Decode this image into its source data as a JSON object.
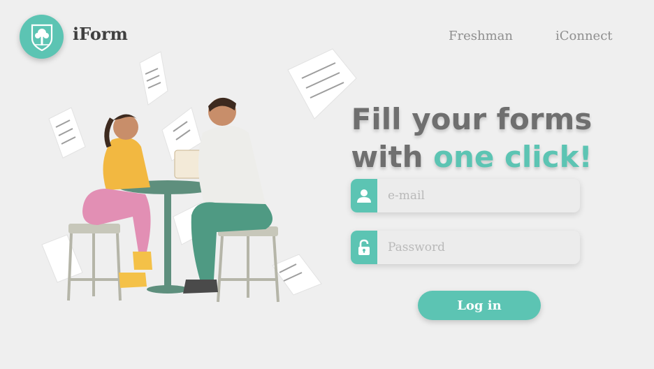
{
  "brand": {
    "name": "iForm"
  },
  "nav": {
    "items": [
      "Freshman",
      "iConnect"
    ]
  },
  "headline": {
    "line1": "Fill your forms",
    "line2_prefix": "with ",
    "line2_accent": "one click!"
  },
  "login_form": {
    "email_placeholder": "e-mail",
    "password_placeholder": "Password",
    "submit_label": "Log in"
  },
  "icons": {
    "logo": "crest-tree-icon",
    "email": "user-icon",
    "password": "unlock-icon"
  },
  "colors": {
    "accent": "#5cc4b3",
    "background": "#efefef",
    "text_dark": "#3f3f3f",
    "text_muted": "#8e8e8e"
  }
}
